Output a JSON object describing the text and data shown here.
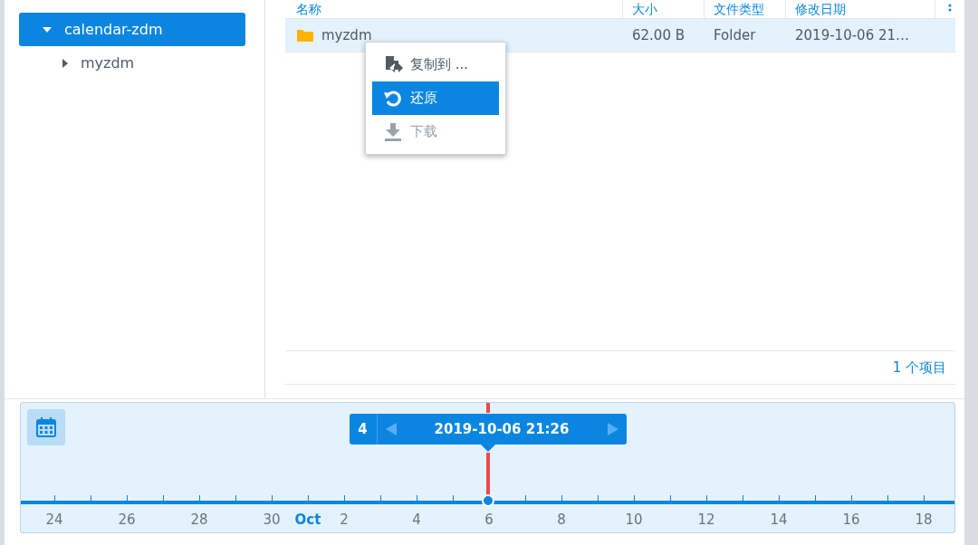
{
  "tree": [
    {
      "label": "calendar-zdm",
      "selected": true,
      "expanded": true,
      "children": [
        {
          "label": "myzdm",
          "selected": false,
          "expanded": false
        }
      ]
    }
  ],
  "table": {
    "columns": [
      "名称",
      "大小",
      "文件类型",
      "修改日期"
    ],
    "rows": [
      {
        "name": "myzdm",
        "size": "62.00 B",
        "type": "Folder",
        "modified": "2019-10-06 21…",
        "selected": true
      }
    ],
    "footer": "1 个项目"
  },
  "context_menu": [
    {
      "label": "复制到 ...",
      "kind": "copy",
      "selected": false,
      "disabled": false
    },
    {
      "label": "还原",
      "kind": "restore",
      "selected": true,
      "disabled": false
    },
    {
      "label": "下载",
      "kind": "download",
      "selected": false,
      "disabled": true
    }
  ],
  "timeline": {
    "count": "4",
    "date": "2019-10-06 21:26",
    "level": 0.5,
    "labels": [
      {
        "text": "24",
        "kind": "day"
      },
      {
        "text": "26",
        "kind": "day"
      },
      {
        "text": "28",
        "kind": "day"
      },
      {
        "text": "30",
        "kind": "day"
      },
      {
        "text": "Oct",
        "kind": "month"
      },
      {
        "text": "2",
        "kind": "day"
      },
      {
        "text": "4",
        "kind": "day"
      },
      {
        "text": "6",
        "kind": "day"
      },
      {
        "text": "8",
        "kind": "day"
      },
      {
        "text": "10",
        "kind": "day"
      },
      {
        "text": "12",
        "kind": "day"
      },
      {
        "text": "14",
        "kind": "day"
      },
      {
        "text": "16",
        "kind": "day"
      },
      {
        "text": "18",
        "kind": "day"
      }
    ]
  }
}
